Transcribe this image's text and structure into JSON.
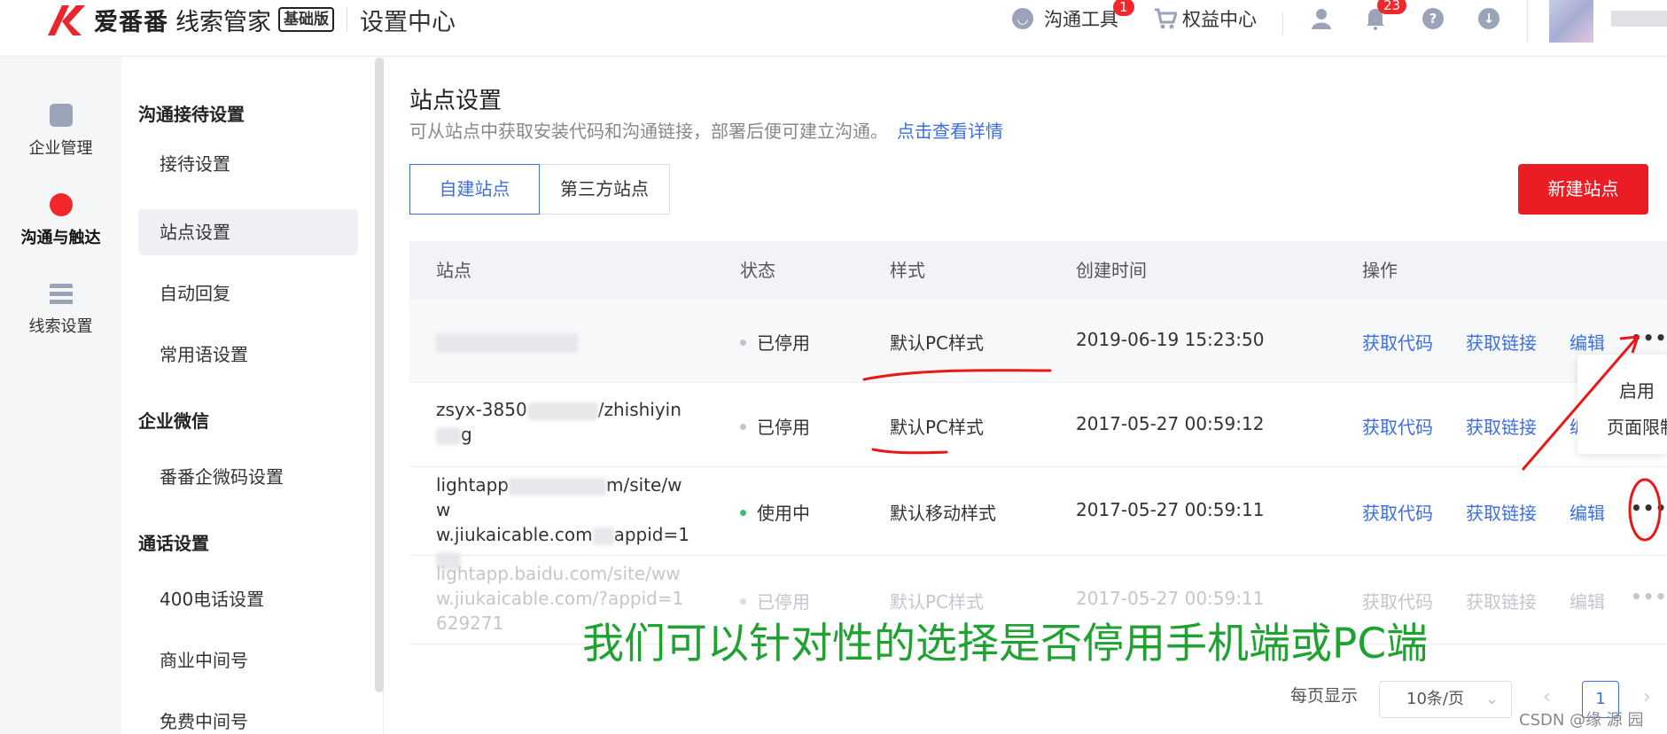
{
  "header": {
    "brand": "爱番番",
    "brand_suffix": "线索管家",
    "edition": "基础版",
    "section_title": "设置中心",
    "tools": [
      {
        "label": "沟通工具",
        "badge": "1",
        "icon": "chat-bubble-icon"
      },
      {
        "label": "权益中心",
        "icon": "cart-icon"
      }
    ],
    "notification_badge": "23",
    "accent_color": "#f0282a"
  },
  "leftnav": {
    "items": [
      {
        "label": "企业管理",
        "icon": "folder-icon"
      },
      {
        "label": "沟通与触达",
        "icon": "smile-bubble-icon",
        "active": true
      },
      {
        "label": "线索设置",
        "icon": "list-bars-icon"
      }
    ]
  },
  "submenu": {
    "groups": [
      {
        "title": "沟通接待设置",
        "items": [
          "接待设置",
          "站点设置",
          "自动回复",
          "常用语设置"
        ]
      },
      {
        "title": "企业微信",
        "items": [
          "番番企微码设置"
        ]
      },
      {
        "title": "通话设置",
        "items": [
          "400电话设置",
          "商业中间号",
          "免费中间号"
        ]
      }
    ],
    "active_item": "站点设置"
  },
  "main": {
    "title": "站点设置",
    "description": "可从站点中获取安装代码和沟通链接，部署后便可建立沟通。",
    "detail_link": "点击查看详情",
    "tabs": [
      "自建站点",
      "第三方站点"
    ],
    "active_tab": "自建站点",
    "new_button": "新建站点",
    "table": {
      "headers": [
        "站点",
        "状态",
        "样式",
        "创建时间",
        "操作"
      ],
      "rows": [
        {
          "site": "",
          "status": "已停用",
          "style": "默认PC样式",
          "created": "2019-06-19 15:23:50",
          "status_active": false
        },
        {
          "site": "zsyx-38503  /zhishiyin g",
          "site_l1": "zsyx-3850",
          "site_l1b": "/zhishiyin",
          "site_l2": "g",
          "status": "已停用",
          "style": "默认PC样式",
          "created": "2017-05-27 00:59:12",
          "status_active": false
        },
        {
          "site_l1": "lightapp",
          "site_l1b": "m/site/ww",
          "site_l2": "w.jiukaicable.com",
          "site_l2b": "appid=1",
          "status": "使用中",
          "style": "默认移动样式",
          "created": "2017-05-27 00:59:11",
          "status_active": true
        },
        {
          "site_l1": "lightapp.baidu.com/site/ww",
          "site_l2": "w.jiukaicable.com/?appid=1",
          "site_l3": "629271",
          "status": "已停用",
          "style": "默认PC样式",
          "created": "2017-05-27 00:59:11",
          "status_active": false
        }
      ],
      "actions": [
        "获取代码",
        "获取链接",
        "编辑",
        "•••"
      ]
    },
    "dropdown": [
      "启用",
      "页面限制"
    ],
    "pagination": {
      "per_page_label": "每页显示",
      "page_size": "10条/页",
      "current_page": "1"
    }
  },
  "annotation_text": "我们可以针对性的选择是否停用手机端或PC端",
  "watermark": "CSDN @缘 源 园"
}
